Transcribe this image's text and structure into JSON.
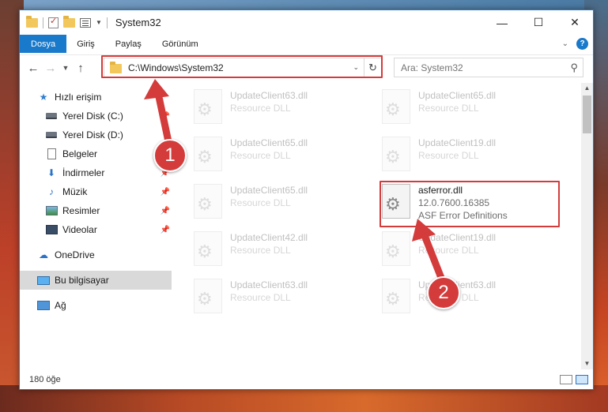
{
  "window": {
    "title": "System32",
    "controls": {
      "minimize": "—",
      "maximize": "☐",
      "close": "✕"
    }
  },
  "ribbon": {
    "tabs": [
      "Dosya",
      "Giriş",
      "Paylaş",
      "Görünüm"
    ],
    "help": "?"
  },
  "nav": {
    "address": "C:\\Windows\\System32",
    "search_placeholder": "Ara: System32"
  },
  "sidebar": {
    "items": [
      {
        "label": "Hızlı erişim",
        "icon": "star-icon"
      },
      {
        "label": "Yerel Disk (C:)",
        "icon": "drive-icon",
        "pinned": true
      },
      {
        "label": "Yerel Disk (D:)",
        "icon": "drive-icon",
        "pinned": false
      },
      {
        "label": "Belgeler",
        "icon": "document-icon",
        "pinned": true
      },
      {
        "label": "İndirmeler",
        "icon": "download-icon",
        "pinned": true
      },
      {
        "label": "Müzik",
        "icon": "music-icon",
        "pinned": true
      },
      {
        "label": "Resimler",
        "icon": "pictures-icon",
        "pinned": true
      },
      {
        "label": "Videolar",
        "icon": "videos-icon",
        "pinned": true
      },
      {
        "label": "OneDrive",
        "icon": "cloud-icon"
      },
      {
        "label": "Bu bilgisayar",
        "icon": "computer-icon",
        "selected": true
      },
      {
        "label": "Ağ",
        "icon": "network-icon"
      }
    ]
  },
  "files": {
    "left": [
      {
        "name": "UpdateClient63.dll",
        "desc": "Resource DLL"
      },
      {
        "name": "UpdateClient65.dll",
        "desc": "Resource DLL"
      },
      {
        "name": "UpdateClient65.dll",
        "desc": "Resource DLL"
      },
      {
        "name": "UpdateClient42.dll",
        "desc": "Resource DLL"
      },
      {
        "name": "UpdateClient63.dll",
        "desc": "Resource DLL"
      }
    ],
    "right": [
      {
        "name": "UpdateClient65.dll",
        "desc": "Resource DLL"
      },
      {
        "name": "UpdateClient19.dll",
        "desc": "Resource DLL"
      },
      {
        "name": "asferror.dll",
        "version": "12.0.7600.16385",
        "desc": "ASF Error Definitions"
      },
      {
        "name": "UpdateClient19.dll",
        "desc": "Resource DLL"
      },
      {
        "name": "UpdateClient63.dll",
        "desc": "Resource DLL"
      }
    ]
  },
  "status": {
    "count": "180 öğe"
  },
  "annotations": {
    "step1": "1",
    "step2": "2",
    "color": "#d43b3b"
  }
}
